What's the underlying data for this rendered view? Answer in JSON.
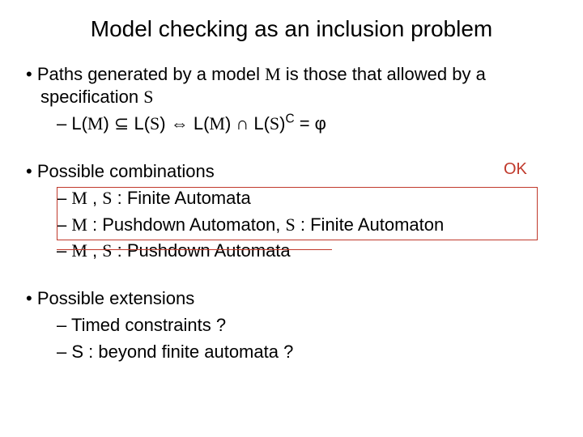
{
  "title": "Model checking as an inclusion problem",
  "section1": {
    "lead_a": "Paths generated by a model ",
    "M": "M",
    "lead_b": " is those that allowed by a specification ",
    "S": "S",
    "formula_a": "L(",
    "formula_b": ") ⊆ L(",
    "formula_c": ")  ⇔  L(",
    "formula_d": ") ∩ L(",
    "formula_e": ")",
    "compC": "C",
    "formula_f": " = φ"
  },
  "section2": {
    "lead": "Possible combinations",
    "item1_a": " , ",
    "item1_b": " : Finite Automata",
    "item2_a": " : Pushdown Automaton, ",
    "item2_b": " : Finite Automaton",
    "item3_a": " , ",
    "item3_b": " : Pushdown Automata",
    "ok": "OK"
  },
  "section3": {
    "lead": "Possible extensions",
    "item1": "Timed constraints ?",
    "item2": "S : beyond finite automata ?"
  }
}
